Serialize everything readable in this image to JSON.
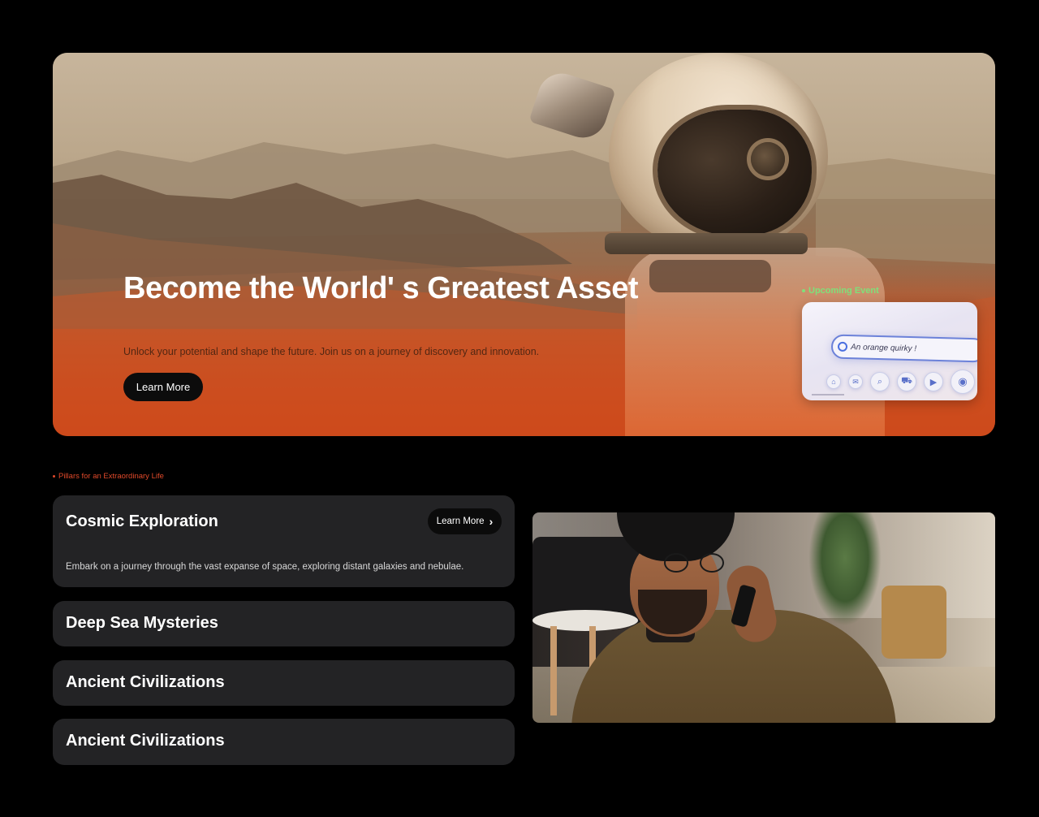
{
  "hero": {
    "title": "Become the World' s Greatest Asset",
    "subtitle": "Unlock your potential and shape the future. Join us on a journey of discovery and innovation.",
    "cta_label": "Learn More"
  },
  "event": {
    "label": "Upcoming Event",
    "search_text": "An orange quirky !",
    "icons": [
      "home-icon",
      "mail-icon",
      "search-icon",
      "cart-icon",
      "play-icon",
      "location-pin-icon"
    ]
  },
  "pillars": {
    "section_label": "Pillars for an Extraordinary Life",
    "items": [
      {
        "title": "Cosmic Exploration",
        "description": "Embark on a journey through the vast expanse of space, exploring distant galaxies and nebulae.",
        "button_label": "Learn More",
        "expanded": true
      },
      {
        "title": "Deep Sea Mysteries",
        "expanded": false
      },
      {
        "title": "Ancient Civilizations",
        "expanded": false
      },
      {
        "title": "Ancient Civilizations",
        "expanded": false
      }
    ]
  },
  "colors": {
    "background": "#000000",
    "hero_accent": "#d8461a",
    "event_label": "#7fe07a",
    "section_label": "#e0492a",
    "card_bg": "#232325",
    "button_bg": "#0b0b0b"
  }
}
